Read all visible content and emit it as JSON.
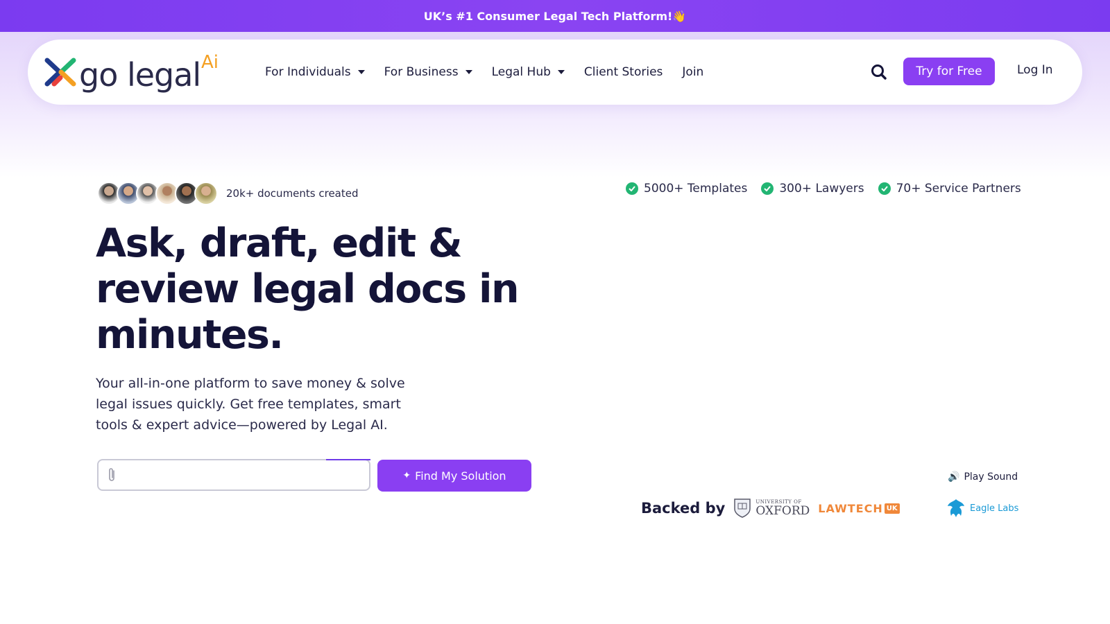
{
  "announcement": {
    "text": "UK’s #1 Consumer Legal Tech Platform!👋"
  },
  "logo": {
    "text": "go legal",
    "ai_text": "Ai"
  },
  "nav": {
    "items": [
      {
        "label": "For Individuals",
        "has_dropdown": true
      },
      {
        "label": "For Business",
        "has_dropdown": true
      },
      {
        "label": "Legal Hub",
        "has_dropdown": true
      },
      {
        "label": "Client Stories",
        "has_dropdown": false
      },
      {
        "label": "Join",
        "has_dropdown": false
      }
    ],
    "search_icon": "search-icon",
    "cta_label": "Try for Free",
    "login_label": "Log In"
  },
  "social_proof": {
    "text": "20k+ documents created",
    "avatar_count": 6
  },
  "highlights": [
    {
      "label": "5000+ Templates",
      "icon": "check-circle-icon"
    },
    {
      "label": "300+ Lawyers",
      "icon": "check-circle-icon"
    },
    {
      "label": "70+ Service Partners",
      "icon": "check-circle-icon"
    }
  ],
  "hero": {
    "headline": "Ask, draft, edit & review legal docs in minutes.",
    "subtext": "Your all-in-one platform to save money & solve legal issues quickly. Get free templates, smart tools & expert advice—powered by Legal AI."
  },
  "search": {
    "value": "",
    "attach_icon": "paperclip-icon",
    "button_label": "Find My Solution",
    "button_icon": "sparkle-icon"
  },
  "media": {
    "play_sound_label": "Play Sound",
    "speaker_icon": "speaker-icon"
  },
  "backers": {
    "label": "Backed by",
    "oxford_small": "UNIVERSITY OF",
    "oxford_big": "OXFORD",
    "lawtech": "LAWTECH",
    "lawtech_uk": "UK",
    "eagle": "Eagle Labs"
  },
  "colors": {
    "brand_purple": "#8a3ff2",
    "check_green": "#22b573",
    "heading": "#141438",
    "lawtech_orange": "#f0883a",
    "eagle_blue": "#1a9ad6"
  }
}
